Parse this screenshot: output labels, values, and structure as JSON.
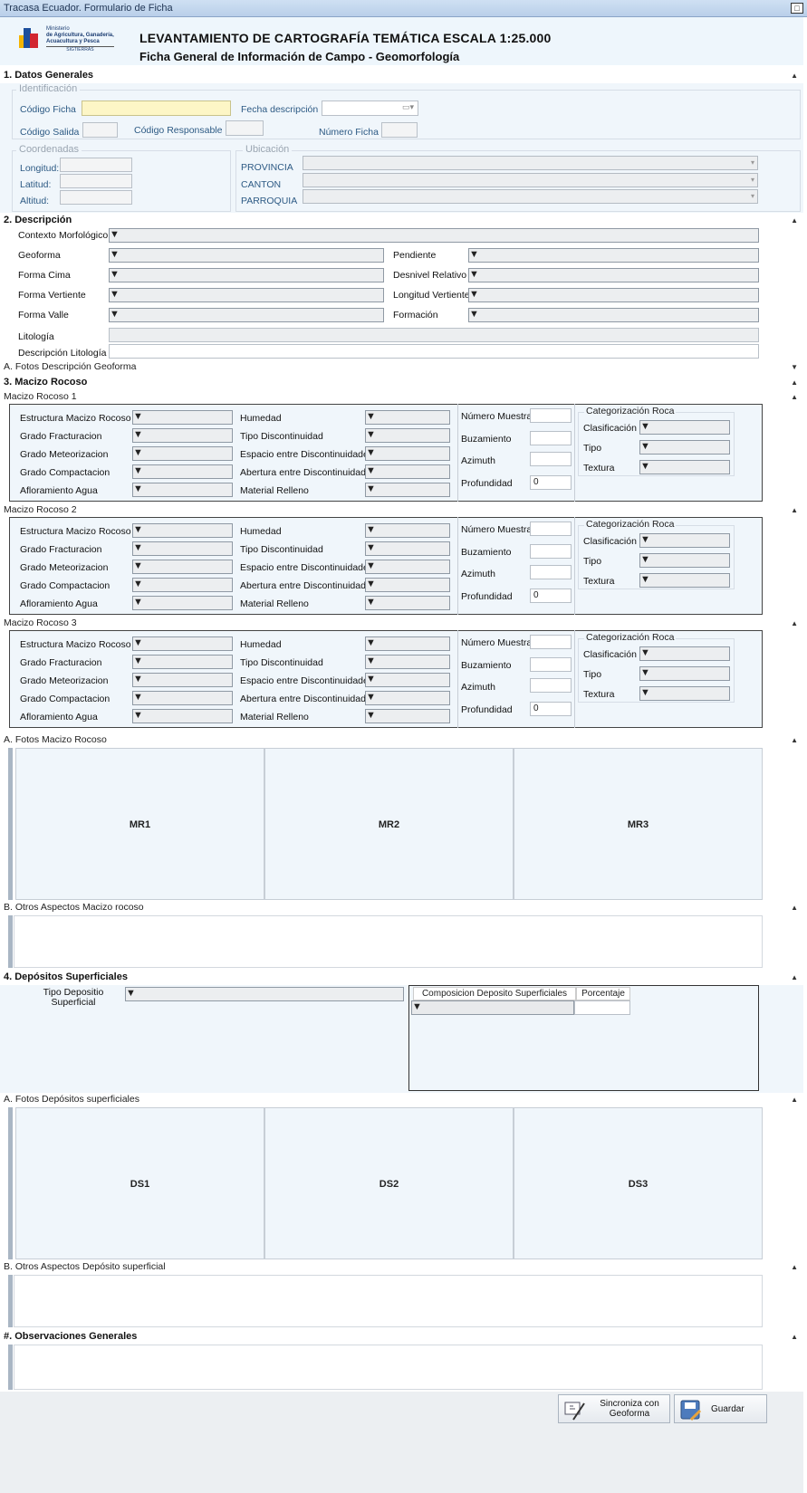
{
  "window": {
    "title": "Tracasa Ecuador. Formulario de Ficha"
  },
  "header": {
    "logo_lines": [
      "Ministerio",
      "de Agricultura, Ganadería,",
      "Acuacultura y Pesca",
      "SIGTIERRAS"
    ],
    "title": "LEVANTAMIENTO DE CARTOGRAFÍA TEMÁTICA ESCALA 1:25.000",
    "subtitle": "Ficha General de Información de Campo - Geomorfología"
  },
  "s1": {
    "title": "1. Datos Generales",
    "ident": "Identificación",
    "codigo_ficha": "Código Ficha",
    "fecha": "Fecha descripción",
    "codigo_salida": "Código Salida",
    "codigo_resp": "Código Responsable",
    "numero_ficha": "Número Ficha",
    "coord": "Coordenadas",
    "longitud": "Longitud:",
    "latitud": "Latitud:",
    "altitud": "Altitud:",
    "ubic": "Ubicación",
    "provincia": "PROVINCIA",
    "canton": "CANTON",
    "parroquia": "PARROQUIA"
  },
  "s2": {
    "title": "2. Descripción",
    "contexto": "Contexto Morfológico",
    "geoforma": "Geoforma",
    "forma_cima": "Forma Cima",
    "forma_vertiente": "Forma Vertiente",
    "forma_valle": "Forma Valle",
    "pendiente": "Pendiente",
    "desnivel": "Desnivel Relativo",
    "long_vertiente": "Longitud Vertiente",
    "formacion": "Formación",
    "litologia": "Litología",
    "desc_litologia": "Descripción Litología",
    "fotos": "A. Fotos Descripción Geoforma"
  },
  "s3": {
    "title": "3. Macizo Rocoso",
    "macizos": [
      {
        "title": "Macizo Rocoso 1"
      },
      {
        "title": "Macizo Rocoso 2"
      },
      {
        "title": "Macizo Rocoso 3"
      }
    ],
    "col1": [
      "Estructura Macizo Rocoso",
      "Grado Fracturacion",
      "Grado Meteorizacion",
      "Grado Compactacion",
      "Afloramiento Agua"
    ],
    "col2": [
      "Humedad",
      "Tipo Discontinuidad",
      "Espacio entre Discontinuidades",
      "Abertura entre Discontinuidades",
      "Material Relleno"
    ],
    "num_muestras": "Número Muestras",
    "buzamiento": "Buzamiento",
    "azimuth": "Azimuth",
    "profundidad": "Profundidad",
    "profundidad_value": "0",
    "cat": "Categorización Roca",
    "clasificacion": "Clasificación",
    "tipo": "Tipo",
    "textura": "Textura",
    "fotos": "A. Fotos Macizo Rocoso",
    "photos": [
      "MR1",
      "MR2",
      "MR3"
    ],
    "otros": "B. Otros Aspectos Macizo rocoso"
  },
  "s4": {
    "title": "4. Depósitos Superficiales",
    "tipo_dep": "Tipo Depositio Superficial",
    "col_comp": "Composicion Deposito Superficiales",
    "col_pct": "Porcentaje",
    "fotos": "A. Fotos Depósitos superficiales",
    "photos": [
      "DS1",
      "DS2",
      "DS3"
    ],
    "otros": "B. Otros Aspectos Depósito superficial"
  },
  "s5": {
    "title": "#. Observaciones Generales"
  },
  "buttons": {
    "sync": "Sincroniza con Geoforma",
    "save": "Guardar"
  },
  "colors": {
    "panel": "#f0f6fb",
    "yellow_field": "#fdf6c6",
    "title_bar": "#c9dcf2"
  }
}
